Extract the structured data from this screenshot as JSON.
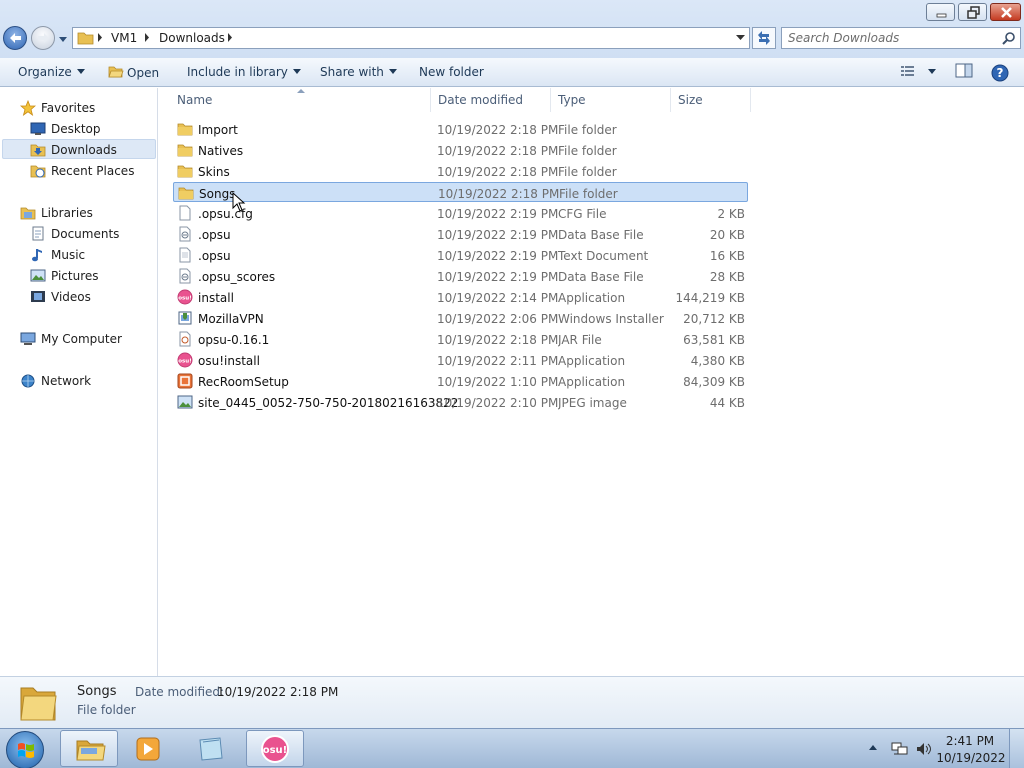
{
  "window": {
    "controls": {
      "minimize": "minimize",
      "maximize": "restore",
      "close": "close"
    }
  },
  "address": {
    "segments": [
      "VM1",
      "Downloads"
    ]
  },
  "search": {
    "placeholder": "Search Downloads"
  },
  "toolbar": {
    "organize": "Organize",
    "open": "Open",
    "include": "Include in library",
    "share": "Share with",
    "new_folder": "New folder"
  },
  "nav": {
    "favorites": {
      "label": "Favorites",
      "items": [
        "Desktop",
        "Downloads",
        "Recent Places"
      ]
    },
    "libraries": {
      "label": "Libraries",
      "items": [
        "Documents",
        "Music",
        "Pictures",
        "Videos"
      ]
    },
    "computer": "My Computer",
    "network": "Network",
    "selected": "Downloads"
  },
  "columns": {
    "name": "Name",
    "date": "Date modified",
    "type": "Type",
    "size": "Size"
  },
  "files": [
    {
      "name": "Import",
      "date": "10/19/2022 2:18 PM",
      "type": "File folder",
      "size": "",
      "icon": "folder-icon"
    },
    {
      "name": "Natives",
      "date": "10/19/2022 2:18 PM",
      "type": "File folder",
      "size": "",
      "icon": "folder-icon"
    },
    {
      "name": "Skins",
      "date": "10/19/2022 2:18 PM",
      "type": "File folder",
      "size": "",
      "icon": "folder-icon"
    },
    {
      "name": "Songs",
      "date": "10/19/2022 2:18 PM",
      "type": "File folder",
      "size": "",
      "icon": "folder-icon",
      "selected": true
    },
    {
      "name": ".opsu.cfg",
      "date": "10/19/2022 2:19 PM",
      "type": "CFG File",
      "size": "2 KB",
      "icon": "file-icon"
    },
    {
      "name": ".opsu",
      "date": "10/19/2022 2:19 PM",
      "type": "Data Base File",
      "size": "20 KB",
      "icon": "database-file-icon"
    },
    {
      "name": ".opsu",
      "date": "10/19/2022 2:19 PM",
      "type": "Text Document",
      "size": "16 KB",
      "icon": "text-file-icon"
    },
    {
      "name": ".opsu_scores",
      "date": "10/19/2022 2:19 PM",
      "type": "Data Base File",
      "size": "28 KB",
      "icon": "database-file-icon"
    },
    {
      "name": "install",
      "date": "10/19/2022 2:14 PM",
      "type": "Application",
      "size": "144,219 KB",
      "icon": "osu-app-icon"
    },
    {
      "name": "MozillaVPN",
      "date": "10/19/2022 2:06 PM",
      "type": "Windows Installer ...",
      "size": "20,712 KB",
      "icon": "installer-icon"
    },
    {
      "name": "opsu-0.16.1",
      "date": "10/19/2022 2:18 PM",
      "type": "JAR File",
      "size": "63,581 KB",
      "icon": "jar-file-icon"
    },
    {
      "name": "osu!install",
      "date": "10/19/2022 2:11 PM",
      "type": "Application",
      "size": "4,380 KB",
      "icon": "osu-app-icon"
    },
    {
      "name": "RecRoomSetup",
      "date": "10/19/2022 1:10 PM",
      "type": "Application",
      "size": "84,309 KB",
      "icon": "recroom-app-icon"
    },
    {
      "name": "site_0445_0052-750-750-20180216163822",
      "date": "10/19/2022 2:10 PM",
      "type": "JPEG image",
      "size": "44 KB",
      "icon": "image-file-icon"
    }
  ],
  "details": {
    "name": "Songs",
    "type": "File folder",
    "date_label": "Date modified:",
    "date_value": "10/19/2022 2:18 PM"
  },
  "taskbar": {
    "tasks": [
      "windows-explorer",
      "windows-media-player",
      "notepad",
      "osu"
    ],
    "active_task": "windows-explorer"
  },
  "clock": {
    "time": "2:41 PM",
    "date": "10/19/2022"
  },
  "colors": {
    "selection": "#cce0f7",
    "selection_border": "#7aa7df",
    "folder": "#e8c053",
    "osu_pink": "#e9528f"
  }
}
